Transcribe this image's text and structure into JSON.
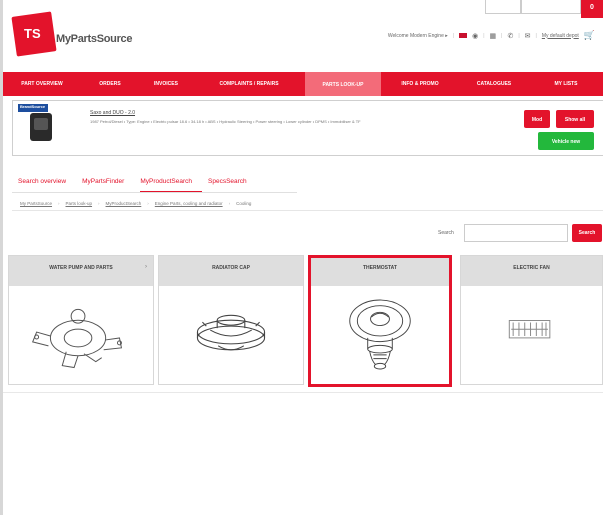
{
  "topbar": {
    "box_a": "",
    "box_b": "",
    "cart_label": "0"
  },
  "header": {
    "logo_text": "TS",
    "brand": "MyPartsSource",
    "welcome": "Welcome Modern Engine ▸",
    "flag": "",
    "help": "",
    "account": "My default depot",
    "cart_icon": "cart-icon"
  },
  "nav": {
    "items": [
      {
        "label": "Part Overview"
      },
      {
        "label": "Orders"
      },
      {
        "label": "Invoices"
      },
      {
        "label": "Complaints / Repairs"
      },
      {
        "label": "Parts Look-Up"
      },
      {
        "label": "Info & Promo"
      },
      {
        "label": "Catalogues"
      },
      {
        "label": "My Lists"
      }
    ]
  },
  "vehicle": {
    "logo": "BrandSource",
    "title": "Saxo and DUO - 2.0",
    "desc": "1987 Petrol/Diesel • Type: Engine • Electric pulsar 18.6 • 34.18 h • ABS • Hydraulic Steering • Power steering • Lower cylinder • DPMS • Immobiliser & TF",
    "btn1": "Mod",
    "btn2": "Show all",
    "btn3": "Vehicle new"
  },
  "tabs": [
    {
      "label": "Search overview"
    },
    {
      "label": "MyPartsFinder"
    },
    {
      "label": "MyProductSearch"
    },
    {
      "label": "SpecsSearch"
    }
  ],
  "breadcrumb": [
    "My PartsSource",
    "Parts look-up",
    "MyProductSearch",
    "Engine Parts, cooling and radiator",
    "Cooling"
  ],
  "search": {
    "label": "Search",
    "placeholder": "",
    "button": "Search"
  },
  "cards": [
    {
      "label": "Water pump and parts",
      "icon": "water-pump-icon"
    },
    {
      "label": "Radiator cap",
      "icon": "radiator-cap-icon"
    },
    {
      "label": "Thermostat",
      "icon": "thermostat-icon"
    },
    {
      "label": "Electric fan",
      "icon": "electric-fan-icon"
    }
  ],
  "colors": {
    "brand_red": "#e3132b",
    "active_nav": "#f36b79",
    "green": "#23b83c"
  }
}
